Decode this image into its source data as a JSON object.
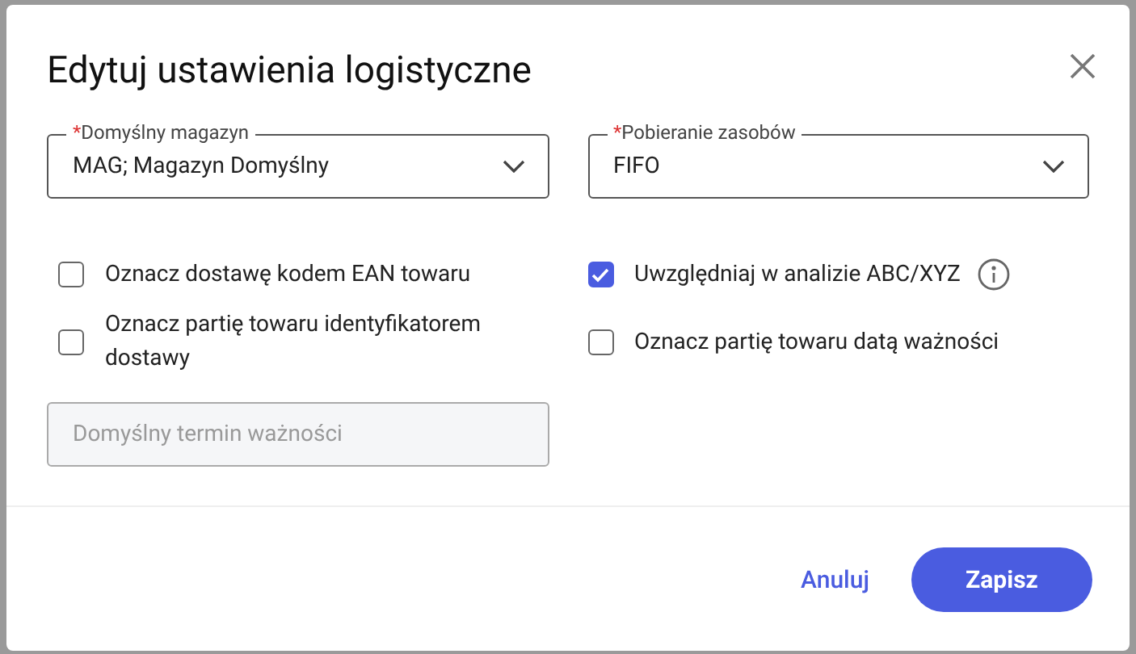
{
  "dialog": {
    "title": "Edytuj ustawienia logistyczne",
    "selects": [
      {
        "label": "Domyślny magazyn",
        "required_mark": "*",
        "value": "MAG; Magazyn Domyślny"
      },
      {
        "label": "Pobieranie zasobów",
        "required_mark": "*",
        "value": "FIFO"
      }
    ],
    "checkboxes": [
      {
        "label": "Oznacz dostawę kodem EAN towaru",
        "checked": false,
        "info": false
      },
      {
        "label": "Uwzględniaj w analizie ABC/XYZ",
        "checked": true,
        "info": true
      },
      {
        "label": "Oznacz partię towaru identyfikatorem dostawy",
        "checked": false,
        "info": false
      },
      {
        "label": "Oznacz partię towaru datą ważności",
        "checked": false,
        "info": false
      }
    ],
    "field": {
      "placeholder": "Domyślny termin ważności",
      "disabled": true
    },
    "buttons": {
      "cancel": "Anuluj",
      "save": "Zapisz"
    }
  }
}
